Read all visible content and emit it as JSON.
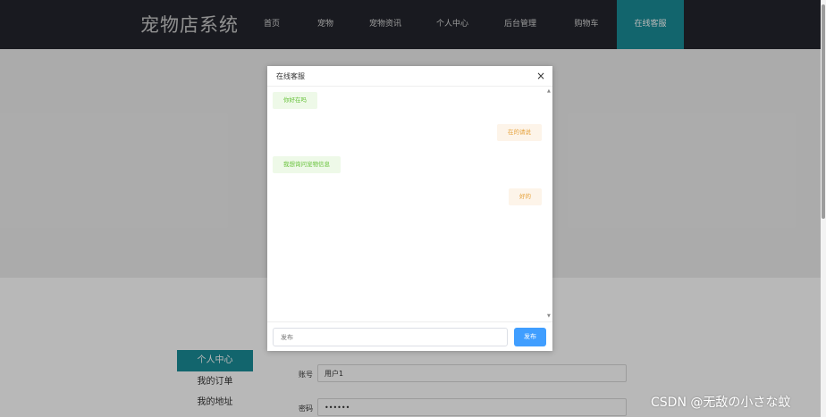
{
  "brand": "宠物店系统",
  "nav": [
    "首页",
    "宠物",
    "宠物资讯",
    "个人中心",
    "后台管理",
    "购物车",
    "在线客服"
  ],
  "sidebar": {
    "active": "个人中心",
    "items": [
      "我的订单",
      "我的地址"
    ]
  },
  "form": {
    "account_label": "账号",
    "account_value": "用户1",
    "password_label": "密码",
    "password_value": "••••••"
  },
  "dialog": {
    "title": "在线客服",
    "close_symbol": "×",
    "messages": [
      {
        "side": "left",
        "text": "你好在吗"
      },
      {
        "side": "right",
        "text": "在的请说"
      },
      {
        "side": "left",
        "text": "我想询问宠物信息"
      },
      {
        "side": "right",
        "text": "好的"
      }
    ],
    "input_placeholder": "发布",
    "send_label": "发布"
  },
  "watermark": "CSDN @无敌の小さな蚊",
  "colors": {
    "nav_bg": "#23252d",
    "accent": "#1a8c97",
    "primary_button": "#409eff",
    "left_bubble": "#67c23a",
    "right_bubble": "#e6a23c"
  }
}
